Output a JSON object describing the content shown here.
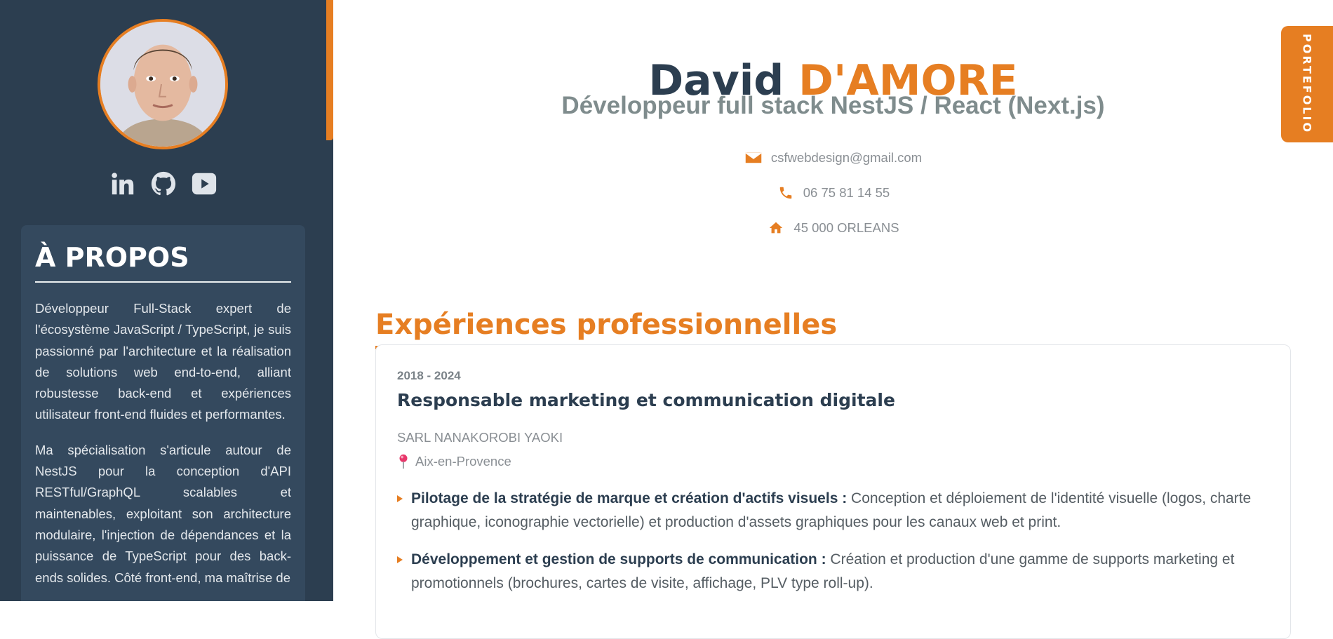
{
  "sidebar": {
    "socials": [
      {
        "icon": "linkedin-icon"
      },
      {
        "icon": "github-icon"
      },
      {
        "icon": "youtube-icon"
      }
    ],
    "about": {
      "title": "À PROPOS",
      "paragraphs": [
        "Développeur Full-Stack expert de l'écosystème JavaScript / TypeScript, je suis passionné par l'architecture et la réalisation de solutions web end-to-end, alliant robustesse back-end et expériences utilisateur front-end fluides et performantes.",
        "Ma spécialisation s'articule autour de NestJS pour la conception d'API RESTful/GraphQL scalables et maintenables, exploitant son architecture modulaire, l'injection de dépendances et la puissance de TypeScript pour des back-ends solides. Côté front-end, ma maîtrise de"
      ]
    }
  },
  "header": {
    "first_name": "David",
    "last_name": "D'AMORE",
    "subtitle": "Développeur full stack NestJS / React (Next.js)",
    "email": "csfwebdesign@gmail.com",
    "phone": "06 75 81 14 55",
    "address": "45 000 ORLEANS"
  },
  "experience": {
    "section_title": "Expériences professionnelles",
    "items": [
      {
        "dates": "2018 - 2024",
        "role": "Responsable marketing et communication digitale",
        "company": "SARL NANAKOROBI YAOKI",
        "location": "Aix-en-Provence",
        "bullets": [
          {
            "title": "Pilotage de la stratégie de marque et création d'actifs visuels :",
            "text": " Conception et déploiement de l'identité visuelle (logos, charte graphique, iconographie vectorielle) et production d'assets graphiques pour les canaux web et print."
          },
          {
            "title": "Développement et gestion de supports de communication :",
            "text": " Création et production d'une gamme de supports marketing et promotionnels (brochures, cartes de visite, affichage, PLV type roll-up)."
          }
        ]
      }
    ]
  },
  "portfolio_tab": "PORTEFOLIO",
  "colors": {
    "accent": "#e67e22",
    "sidebar_bg": "#2c3e50",
    "about_bg": "#34495e",
    "dark_text": "#2c3e50"
  }
}
